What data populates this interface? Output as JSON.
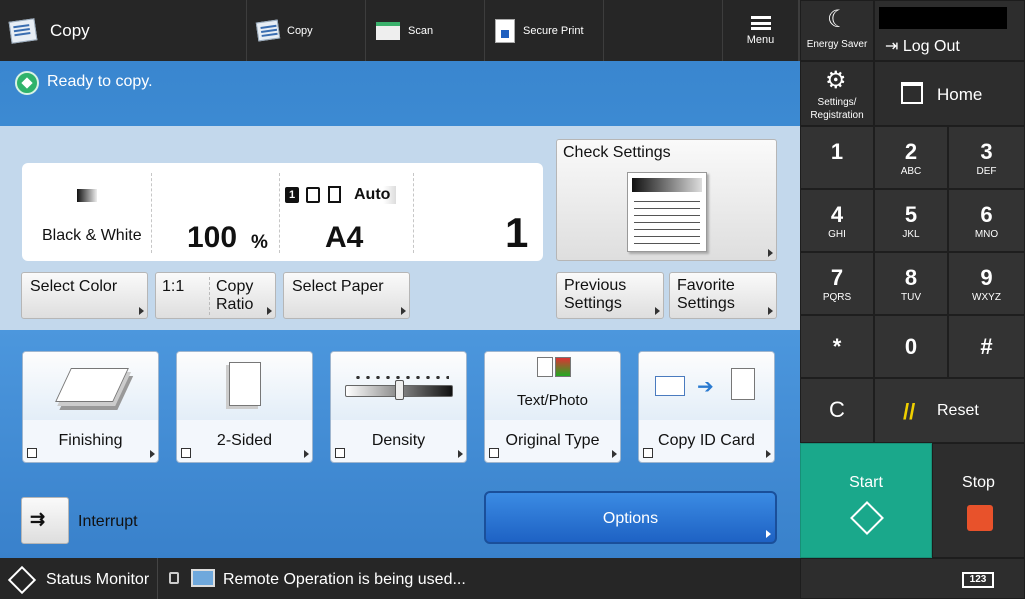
{
  "topbar": {
    "app_title": "Copy",
    "shortcuts": [
      {
        "label": "Copy",
        "icon": "copy-icon"
      },
      {
        "label": "Scan",
        "icon": "scan-icon"
      },
      {
        "label": "Secure Print",
        "icon": "lock-icon"
      }
    ],
    "menu_label": "Menu"
  },
  "status": {
    "message": "Ready to copy."
  },
  "settings_panel": {
    "color_mode": "Black & White",
    "ratio_value": "100",
    "ratio_unit": "%",
    "paper_auto": "Auto",
    "paper_size": "A4",
    "copies": "1"
  },
  "buttons": {
    "select_color": "Select Color",
    "copy_ratio_value": "1:1",
    "copy_ratio_label_1": "Copy",
    "copy_ratio_label_2": "Ratio",
    "select_paper": "Select Paper",
    "check_settings": "Check Settings",
    "previous_1": "Previous",
    "previous_2": "Settings",
    "favorite_1": "Favorite",
    "favorite_2": "Settings",
    "interrupt": "Interrupt",
    "options": "Options"
  },
  "functions": [
    {
      "label": "Finishing",
      "icon": "finishing-icon"
    },
    {
      "label": "2-Sided",
      "icon": "two-sided-icon"
    },
    {
      "label": "Density",
      "icon": "density-slider-icon"
    },
    {
      "label": "Original Type",
      "sub": "Text/Photo",
      "icon": "original-type-icon"
    },
    {
      "label": "Copy ID Card",
      "icon": "id-card-icon"
    }
  ],
  "bottombar": {
    "status_monitor": "Status Monitor",
    "remote": "Remote Operation is being used...",
    "keypad_toggle": "123"
  },
  "right": {
    "energy_saver": "Energy Saver",
    "log_out": "Log Out",
    "settings_1": "Settings/",
    "settings_2": "Registration",
    "home": "Home",
    "reset": "Reset",
    "start": "Start",
    "stop": "Stop",
    "keys": [
      {
        "n": "1",
        "s": ""
      },
      {
        "n": "2",
        "s": "ABC"
      },
      {
        "n": "3",
        "s": "DEF"
      },
      {
        "n": "4",
        "s": "GHI"
      },
      {
        "n": "5",
        "s": "JKL"
      },
      {
        "n": "6",
        "s": "MNO"
      },
      {
        "n": "7",
        "s": "PQRS"
      },
      {
        "n": "8",
        "s": "TUV"
      },
      {
        "n": "9",
        "s": "WXYZ"
      },
      {
        "n": "*",
        "s": ""
      },
      {
        "n": "0",
        "s": ""
      },
      {
        "n": "#",
        "s": ""
      },
      {
        "n": "C",
        "s": ""
      }
    ]
  },
  "colors": {
    "start": "#1aa88b",
    "accent": "#3a86cf",
    "stop": "#e8522b"
  }
}
